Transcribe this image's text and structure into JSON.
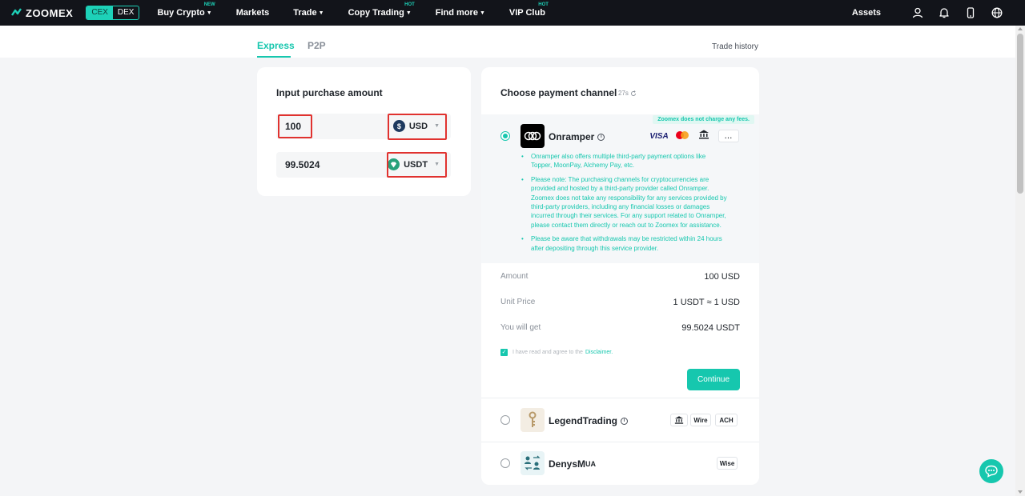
{
  "nav": {
    "logo": "ZOOMEX",
    "cex": "CEX",
    "dex": "DEX",
    "items": [
      {
        "label": "Buy Crypto",
        "tag": "NEW",
        "dropdown": true
      },
      {
        "label": "Markets",
        "tag": "",
        "dropdown": false
      },
      {
        "label": "Trade",
        "tag": "",
        "dropdown": true
      },
      {
        "label": "Copy Trading",
        "tag": "HOT",
        "dropdown": true
      },
      {
        "label": "Find more",
        "tag": "",
        "dropdown": true
      },
      {
        "label": "VIP Club",
        "tag": "HOT",
        "dropdown": false
      }
    ],
    "assets": "Assets",
    "icons": [
      "user-icon",
      "bell-icon",
      "phone-icon",
      "globe-icon"
    ]
  },
  "tabs": {
    "express": "Express",
    "p2p": "P2P",
    "trade_history": "Trade history"
  },
  "purchase": {
    "title": "Input purchase amount",
    "pay_amount": "100",
    "pay_currency": "USD",
    "receive_amount": "99.5024",
    "receive_currency": "USDT"
  },
  "payment": {
    "title": "Choose payment channel",
    "timer": "27s",
    "fee_banner": "Zoomex does not charge any fees.",
    "onramper": {
      "name": "Onramper",
      "methods": [
        "VISA",
        "..."
      ],
      "notes": [
        "Onramper also offers multiple third-party payment options like Topper, MoonPay, Alchemy Pay, etc.",
        "Please note: The purchasing channels for cryptocurrencies are provided and hosted by a third-party provider called Onramper. Zoomex does not take any responsibility for any services provided by third-party providers, including any financial losses or damages incurred through their services. For any support related to Onramper, please contact them directly or reach out to Zoomex for assistance.",
        "Please be aware that withdrawals may be restricted within 24 hours after depositing through this service provider."
      ]
    },
    "details": {
      "amount_label": "Amount",
      "amount_value": "100 USD",
      "unit_price_label": "Unit Price",
      "unit_price_value": "1 USDT ≈ 1 USD",
      "get_label": "You will get",
      "get_value": "99.5024 USDT"
    },
    "agree_text": "I have read and agree to the",
    "agree_link": "Disclaimer.",
    "continue": "Continue",
    "legend": {
      "name": "LegendTrading",
      "methods": [
        "Wire",
        "ACH"
      ]
    },
    "denys": {
      "name": "DenysM",
      "name_suffix": "UA",
      "methods": [
        "Wise"
      ]
    }
  },
  "colors": {
    "accent": "#16c7ae",
    "nav_bg": "#12141a",
    "highlight": "#e0322f"
  }
}
